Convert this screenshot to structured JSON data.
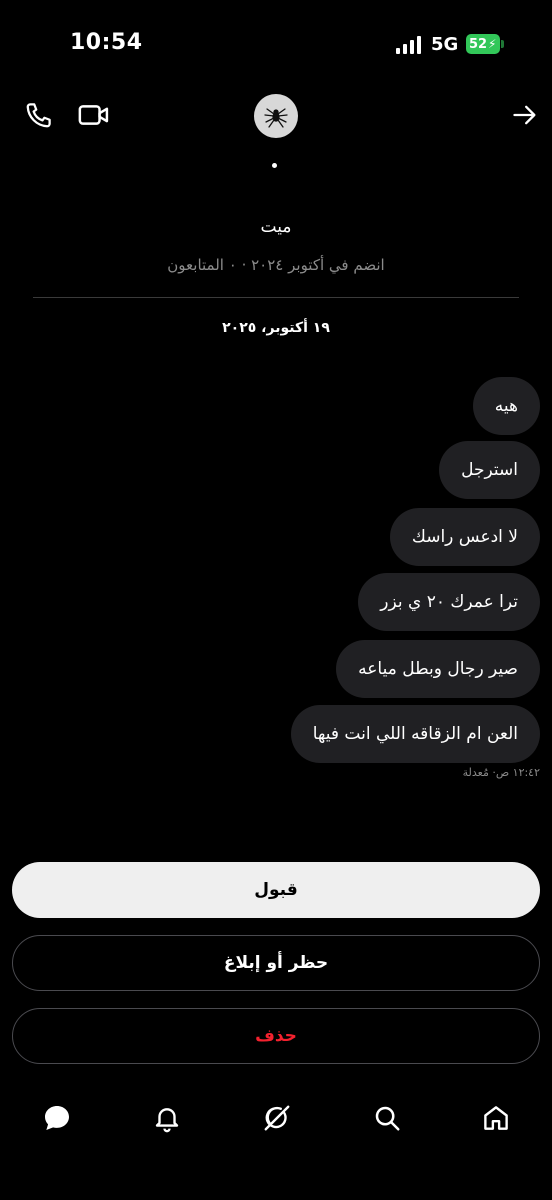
{
  "status_bar": {
    "time": "10:54",
    "network": "5G",
    "battery": "52"
  },
  "header": {
    "icons": [
      "phone-icon",
      "video-icon",
      "arrow-right-icon"
    ]
  },
  "profile": {
    "name": "ميت",
    "joined_text": "انضم في أكتوبر ٢٠٢٤ · ٠ المتابعون"
  },
  "conversation": {
    "date": "١٩ أكتوبر، ٢٠٢٥",
    "messages": [
      "هيه",
      "استرجل",
      "لا ادعس راسك",
      "ترا عمرك ٢٠ ي بزر",
      "صير رجال وبطل مياعه",
      "العن ام الزقاقه اللي انت فيها"
    ],
    "meta": "١٢:٤٢ ص· مُعدلة"
  },
  "actions": {
    "accept": "قبول",
    "block_report": "حظر أو إبلاغ",
    "delete": "حذف"
  },
  "colors": {
    "background": "#000000",
    "bubble": "#202023",
    "accept_bg": "#efefef",
    "delete_text": "#f4212e",
    "battery": "#32c759",
    "muted_text": "#8b8b8b"
  },
  "bottom_nav": {
    "icons": [
      "messages-icon",
      "notifications-icon",
      "grok-icon",
      "search-icon",
      "home-icon"
    ]
  }
}
